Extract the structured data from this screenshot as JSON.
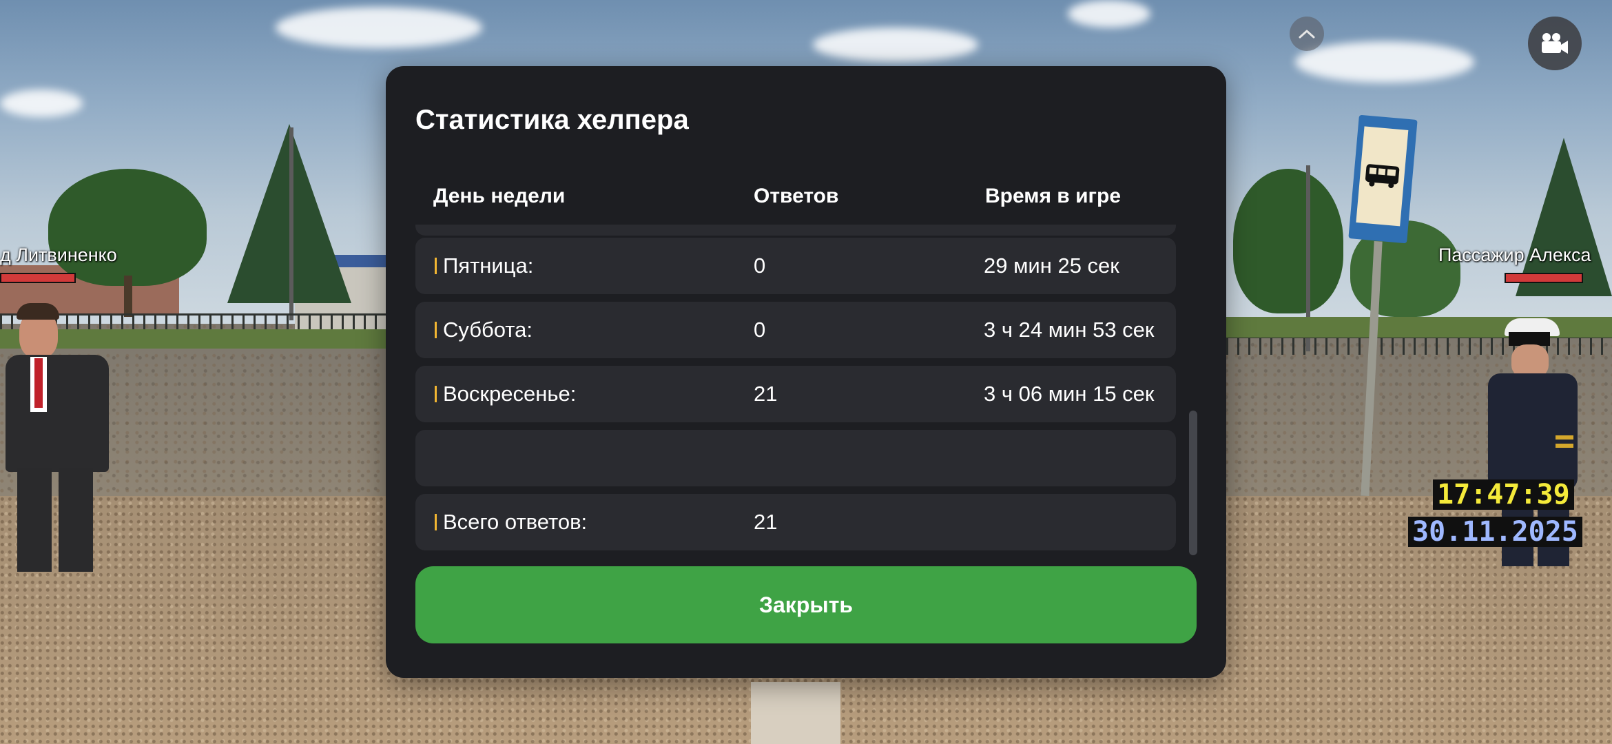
{
  "modal": {
    "title": "Статистика хелпера",
    "columns": [
      "День недели",
      "Ответов",
      "Время в игре"
    ],
    "rows": [
      {
        "day": "",
        "answers": "",
        "time": ""
      },
      {
        "day": "Пятница:",
        "answers": "0",
        "time": "29 мин 25 сек"
      },
      {
        "day": "Суббота:",
        "answers": "0",
        "time": "3 ч 24 мин 53 сек"
      },
      {
        "day": "Воскресенье:",
        "answers": "21",
        "time": "3 ч 06 мин 15 сек"
      },
      {
        "day": "",
        "answers": "",
        "time": ""
      },
      {
        "day": "Всего ответов:",
        "answers": "21",
        "time": ""
      }
    ],
    "close_label": "Закрыть",
    "accent_color": "#f2b632",
    "button_color": "#3fa345"
  },
  "hud": {
    "time": "17:47:39",
    "date": "30.11.2025",
    "collapse_icon": "chevron-up-icon",
    "camera_icon": "video-camera-icon"
  },
  "players": {
    "left_name": "д Литвиненко",
    "right_name": "Пассажир Алекса"
  }
}
